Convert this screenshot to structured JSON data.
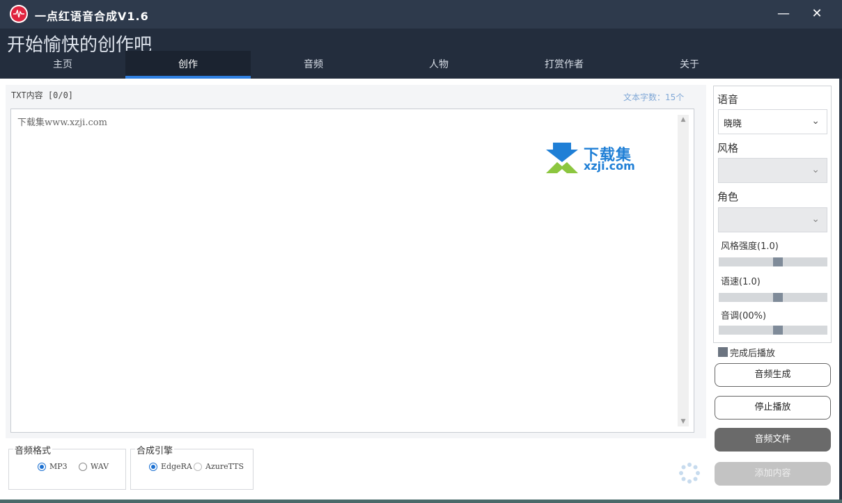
{
  "window": {
    "title": "一点红语音合成V1.6",
    "minimize_icon": "minimize-icon",
    "close_icon": "close-icon"
  },
  "header": {
    "slogan": "开始愉快的创作吧"
  },
  "tabs": [
    {
      "label": "主页"
    },
    {
      "label": "创作",
      "active": true
    },
    {
      "label": "音频"
    },
    {
      "label": "人物"
    },
    {
      "label": "打赏作者"
    },
    {
      "label": "关于"
    }
  ],
  "editor": {
    "txt_label": "TXT内容  [0/0]",
    "char_count": "文本字数：15个",
    "text": "下载集www.xzji.com",
    "watermark_cn": "下载集",
    "watermark_en": "xzji.com"
  },
  "audio_format": {
    "legend": "音频格式",
    "options": [
      {
        "label": "MP3",
        "selected": true
      },
      {
        "label": "WAV",
        "selected": false
      }
    ]
  },
  "engine": {
    "legend": "合成引擎",
    "options": [
      {
        "label": "EdgeRA",
        "selected": true
      },
      {
        "label": "AzureTTS",
        "selected": false
      }
    ]
  },
  "settings": {
    "voice_label": "语音",
    "voice_value": "晓晓",
    "style_label": "风格",
    "style_value": "",
    "role_label": "角色",
    "role_value": "",
    "style_strength_label": "风格强度(1.0)",
    "style_strength": 0.55,
    "speed_label": "语速(1.0)",
    "speed": 0.55,
    "pitch_label": "音调(00%)",
    "pitch": 0.55
  },
  "play_after": {
    "label": "完成后播放",
    "checked": true
  },
  "buttons": {
    "generate": "音频生成",
    "stop": "停止播放",
    "audio_file": "音频文件",
    "add_content": "添加内容"
  },
  "colors": {
    "titlebar": "#2e3a4c",
    "header": "#232d3d",
    "accent": "#2f7fe0",
    "logo": "#e0243f"
  }
}
